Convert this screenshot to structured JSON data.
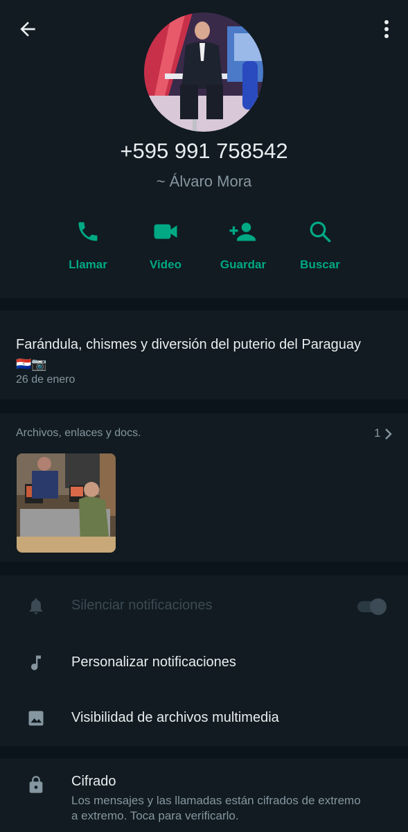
{
  "header": {
    "phone": "+595 991 758542",
    "pushname": "~ Álvaro Mora",
    "avatar_alt": "profile-photo"
  },
  "actions": [
    {
      "label": "Llamar",
      "icon": "phone-icon"
    },
    {
      "label": "Video",
      "icon": "video-camera-icon"
    },
    {
      "label": "Guardar",
      "icon": "add-contact-icon"
    },
    {
      "label": "Buscar",
      "icon": "search-icon"
    }
  ],
  "about": {
    "text": "Farándula, chismes y diversión del puterio del Paraguay",
    "emojis": "🇵🇾📷",
    "date": "26 de enero"
  },
  "media": {
    "title": "Archivos, enlaces y docs.",
    "count": "1"
  },
  "settings": {
    "mute": {
      "label": "Silenciar notificaciones",
      "enabled": false
    },
    "custom": {
      "label": "Personalizar notificaciones"
    },
    "visibility": {
      "label": "Visibilidad de archivos multimedia"
    }
  },
  "encryption": {
    "title": "Cifrado",
    "subtitle": "Los mensajes y las llamadas están cifrados de extremo a extremo. Toca para verificarlo."
  },
  "colors": {
    "accent": "#00a884",
    "background": "#0b141a",
    "panel": "#111b21",
    "secondary_text": "#8696a0"
  }
}
